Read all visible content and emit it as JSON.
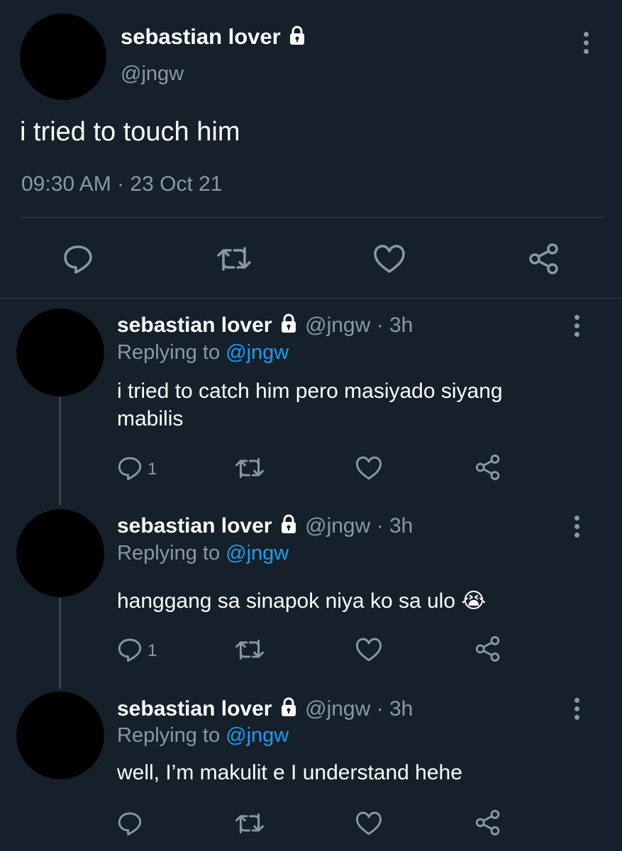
{
  "main_tweet": {
    "display_name": "sebastian lover",
    "handle": "@jngw",
    "text": "i tried to touch him",
    "timestamp": "09:30 AM · 23 Oct 21",
    "actions": [
      "reply-icon",
      "retweet-icon",
      "like-icon",
      "share-icon"
    ]
  },
  "replies": [
    {
      "display_name": "sebastian lover",
      "handle_time": "@jngw · 3h",
      "replying_prefix": "Replying to",
      "replying_handle": "@jngw",
      "text_line1": "i tried to catch him pero masiyado siyang",
      "text_line2": "mabilis",
      "reply_count": "1"
    },
    {
      "display_name": "sebastian lover",
      "handle_time": "@jngw · 3h",
      "replying_prefix": "Replying to",
      "replying_handle": "@jngw",
      "text_line1": "hanggang sa sinapok niya ko sa ulo 😭",
      "reply_count": "1"
    },
    {
      "display_name": "sebastian lover",
      "handle_time": "@jngw · 3h",
      "replying_prefix": "Replying to",
      "replying_handle": "@jngw",
      "text_line1": "well, I’m makulit e I understand hehe",
      "reply_count": ""
    }
  ],
  "colors": {
    "background": "#15202b",
    "muted": "#8899a6",
    "link": "#1d9bf0",
    "divider": "#38444d"
  }
}
